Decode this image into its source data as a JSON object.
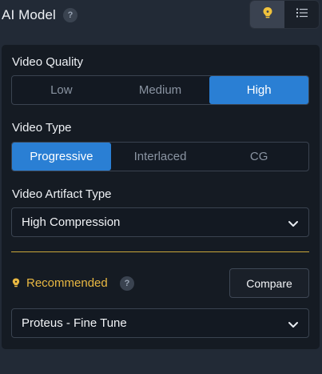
{
  "header": {
    "title": "AI Model",
    "help_glyph": "?",
    "view_toggle": {
      "bulb_icon": "lightbulb-icon",
      "list_icon": "list-icon",
      "active": "bulb"
    }
  },
  "video_quality": {
    "label": "Video Quality",
    "options": [
      "Low",
      "Medium",
      "High"
    ],
    "selected": "High"
  },
  "video_type": {
    "label": "Video Type",
    "options": [
      "Progressive",
      "Interlaced",
      "CG"
    ],
    "selected": "Progressive"
  },
  "artifact_type": {
    "label": "Video Artifact Type",
    "value": "High Compression"
  },
  "recommended": {
    "label": "Recommended",
    "help_glyph": "?",
    "compare_label": "Compare",
    "model_value": "Proteus - Fine Tune"
  },
  "colors": {
    "accent": "#2a7fd4",
    "recommended": "#e9b842",
    "panel": "#151b23",
    "background": "#222a36"
  }
}
